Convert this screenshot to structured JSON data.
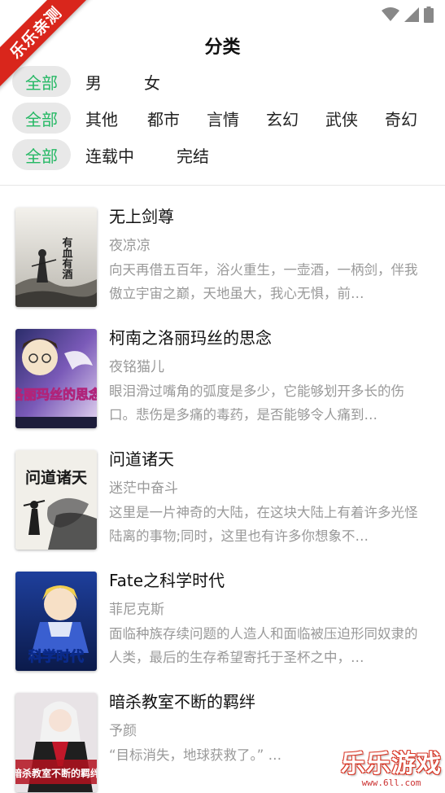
{
  "ribbon": {
    "text": "乐乐亲测"
  },
  "header": {
    "title": "分类"
  },
  "filters": {
    "gender": [
      {
        "label": "全部",
        "active": true
      },
      {
        "label": "男",
        "active": false
      },
      {
        "label": "女",
        "active": false
      }
    ],
    "genre": [
      {
        "label": "全部",
        "active": true
      },
      {
        "label": "其他",
        "active": false
      },
      {
        "label": "都市",
        "active": false
      },
      {
        "label": "言情",
        "active": false
      },
      {
        "label": "玄幻",
        "active": false
      },
      {
        "label": "武侠",
        "active": false
      },
      {
        "label": "奇幻",
        "active": false
      }
    ],
    "status": [
      {
        "label": "全部",
        "active": true
      },
      {
        "label": "连载中",
        "active": false
      },
      {
        "label": "完结",
        "active": false
      }
    ]
  },
  "books": [
    {
      "title": "无上剑尊",
      "author": "夜凉凉",
      "description": "向天再借五百年，浴火重生，一壶酒，一柄剑，伴我傲立宇宙之巅，天地虽大，我心无惧，前…",
      "cover_text": "有血有酒"
    },
    {
      "title": "柯南之洛丽玛丝的思念",
      "author": "夜铭猫儿",
      "description": "眼泪滑过嘴角的弧度是多少，它能够划开多长的伤口。悲伤是多痛的毒药，是否能够令人痛到…",
      "cover_text": "洛丽玛丝的思念"
    },
    {
      "title": "问道诸天",
      "author": "迷茫中奋斗",
      "description": "这里是一片神奇的大陆，在这块大陆上有着许多光怪陆离的事物;同时，这里也有许多你想象不…",
      "cover_text": "问道诸天"
    },
    {
      "title": "Fate之科学时代",
      "author": "菲尼克斯",
      "description": "面临种族存续问题的人造人和面临被压迫形同奴隶的人类，最后的生存希望寄托于圣杯之中，…",
      "cover_text": "科学时代"
    },
    {
      "title": "暗杀教室不断的羁绊",
      "author": "予颜",
      "description": "“目标消失，地球获救了。” …",
      "cover_text": "暗杀教室不断的羁绊"
    }
  ],
  "watermark": {
    "main": "乐乐游戏",
    "sub": "www.6ll.com"
  },
  "colors": {
    "accent": "#25b864",
    "ribbon": "#d9261c",
    "chip_bg": "#e8e8e8",
    "muted": "#999999"
  }
}
